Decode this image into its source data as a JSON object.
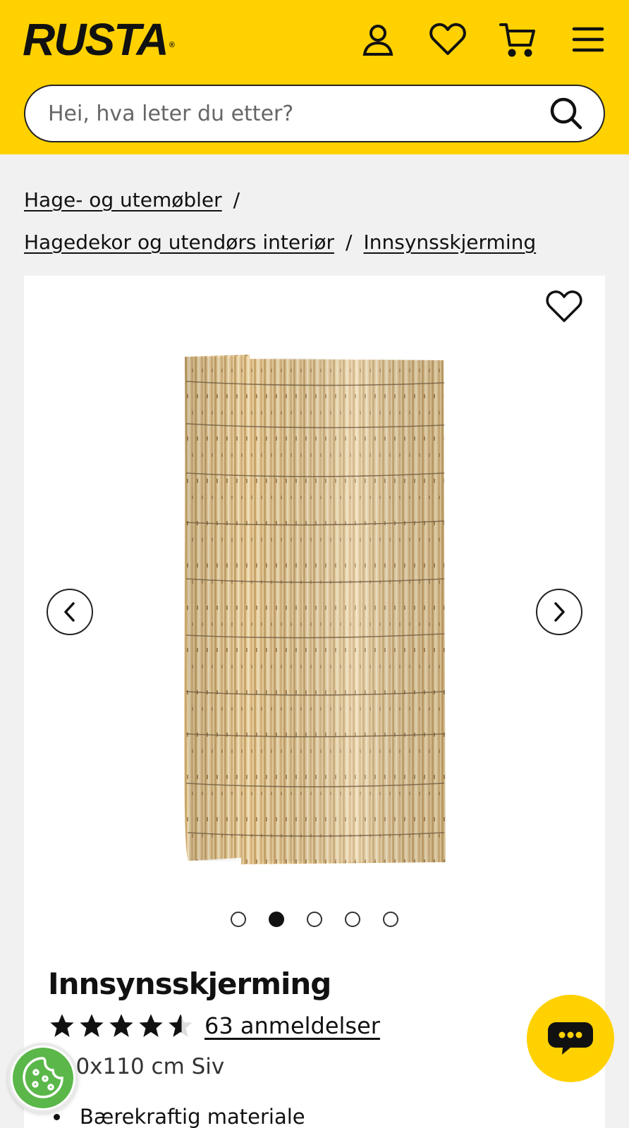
{
  "header": {
    "logo_text": "RUSTA",
    "logo_mark": "®",
    "icons": [
      "user-icon",
      "heart-icon",
      "cart-icon",
      "menu-icon"
    ],
    "search_placeholder": "Hei, hva leter du etter?",
    "background_color": "#FFD100"
  },
  "breadcrumb": {
    "items": [
      "Hage- og utemøbler",
      "Hagedekor og utendørs interiør",
      "Innsynsskjerming"
    ],
    "separator": "/"
  },
  "product": {
    "title": "Innsynsskjerming",
    "rating_stars": 4.5,
    "rating_max": 5,
    "reviews_text": "63 anmeldelser",
    "variant_text": "300x110 cm Siv",
    "features": [
      "Bærekraftig materiale"
    ],
    "gallery": {
      "image_count": 5,
      "active_index": 1
    }
  },
  "floating": {
    "chat_icon": "chat-icon",
    "cookie_icon": "cookie-icon"
  }
}
